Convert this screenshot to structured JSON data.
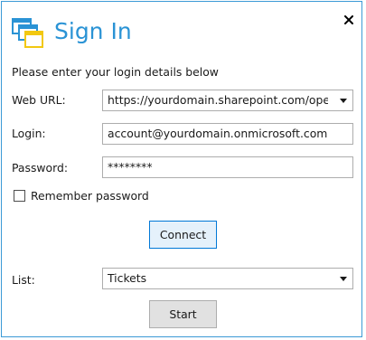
{
  "dialog": {
    "title": "Sign In",
    "intro": "Please enter your login details below",
    "close_icon": "close-icon",
    "app_icon": "windows-stack-icon"
  },
  "form": {
    "web_url_label": "Web URL:",
    "web_url_value": "https://yourdomain.sharepoint.com/oper",
    "login_label": "Login:",
    "login_value": "account@yourdomain.onmicrosoft.com",
    "password_label": "Password:",
    "password_value": "********",
    "remember_label": "Remember password",
    "remember_checked": false,
    "connect_label": "Connect",
    "list_label": "List:",
    "list_value": "Tickets",
    "start_label": "Start"
  },
  "colors": {
    "accent": "#2a93d5",
    "border": "#3c9ad6",
    "icon_yellow": "#f2c811"
  }
}
